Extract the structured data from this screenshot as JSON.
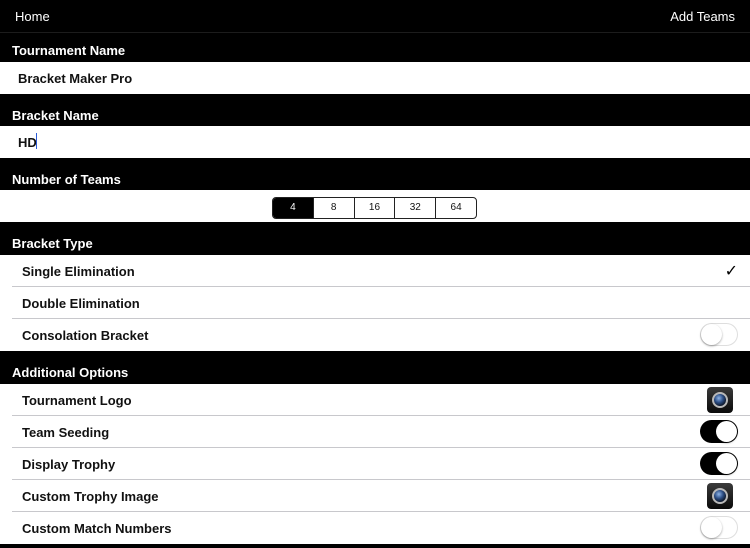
{
  "nav": {
    "left_label": "Home",
    "right_label": "Add Teams"
  },
  "tournament": {
    "header": "Tournament Name",
    "value": "Bracket Maker Pro"
  },
  "bracket": {
    "header": "Bracket Name",
    "value": "HD"
  },
  "teams": {
    "header": "Number of Teams",
    "options": [
      "4",
      "8",
      "16",
      "32",
      "64"
    ],
    "selected": "4"
  },
  "bracket_type": {
    "header": "Bracket Type",
    "single": "Single Elimination",
    "double": "Double Elimination",
    "consolation": "Consolation Bracket",
    "checkmark": "✓"
  },
  "options": {
    "header": "Additional Options",
    "logo": "Tournament Logo",
    "seeding": "Team Seeding",
    "trophy": "Display Trophy",
    "trophy_image": "Custom Trophy Image",
    "match_numbers": "Custom Match Numbers"
  }
}
